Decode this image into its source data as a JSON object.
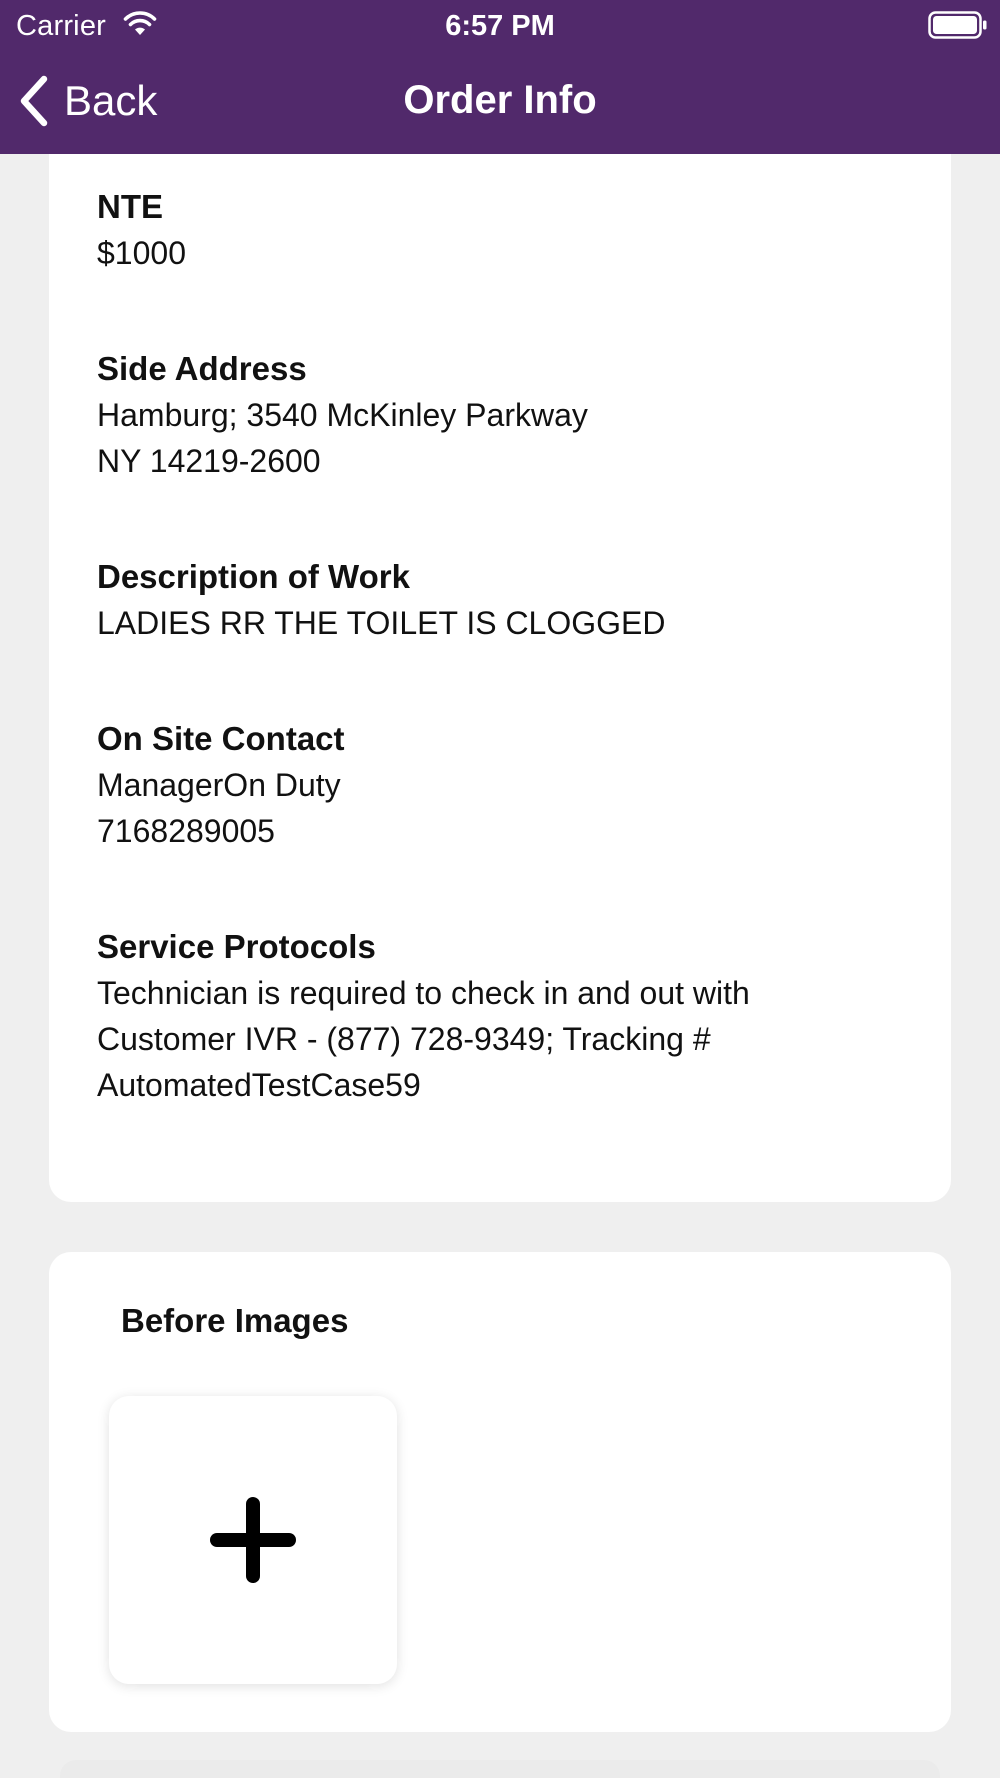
{
  "status_bar": {
    "carrier": "Carrier",
    "time": "6:57 PM",
    "icons": [
      "wifi-icon",
      "battery-icon"
    ]
  },
  "nav": {
    "back_label": "Back",
    "back_icon": "chevron-left-icon",
    "title": "Order Info"
  },
  "order_fields": {
    "nte": {
      "label": "NTE",
      "value": "$1000"
    },
    "side_address": {
      "label": "Side Address",
      "line1": "Hamburg; 3540 McKinley Parkway",
      "line2": "NY 14219-2600"
    },
    "description": {
      "label": "Description of Work",
      "value": "LADIES RR THE TOILET IS CLOGGED"
    },
    "on_site_contact": {
      "label": "On Site Contact",
      "name": "ManagerOn Duty",
      "phone": "7168289005"
    },
    "service_protocols": {
      "label": "Service Protocols",
      "line1": "Technician is required to check in and out with",
      "line2": "Customer IVR - (877) 728-9349; Tracking #",
      "line3": "AutomatedTestCase59"
    }
  },
  "before_images": {
    "title": "Before Images",
    "add_icon": "plus-icon"
  },
  "colors": {
    "header_bg": "#51296b",
    "header_text": "#ffffff",
    "page_bg": "#efefef",
    "card_bg": "#ffffff"
  }
}
